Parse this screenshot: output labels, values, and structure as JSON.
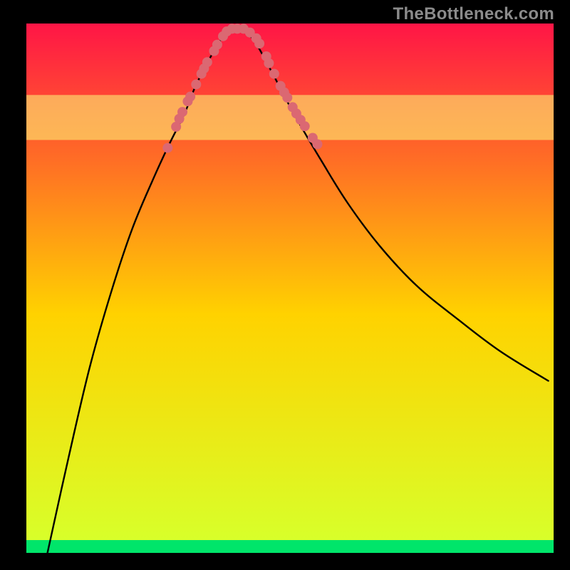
{
  "watermark": "TheBottleneck.com",
  "chart_data": {
    "type": "line",
    "title": "",
    "xlabel": "",
    "ylabel": "",
    "xlim": [
      0,
      100
    ],
    "ylim": [
      0,
      100
    ],
    "grid": false,
    "legend": false,
    "background_gradient": {
      "top": "#ff1546",
      "mid": "#ffd200",
      "bottom": "#00e56a"
    },
    "bottom_highlight_band": {
      "y_from": 78,
      "y_to": 86.5,
      "color": "#fbff7a"
    },
    "series": [
      {
        "name": "bottleneck-curve",
        "color": "#000000",
        "x": [
          4,
          8,
          12,
          16,
          20,
          24,
          27,
          30,
          32,
          34,
          36,
          37.5,
          39,
          40.5,
          42,
          44,
          47,
          51,
          56,
          61,
          67,
          74,
          82,
          90,
          99
        ],
        "y": [
          0,
          18,
          35,
          49,
          61,
          70.5,
          77,
          83,
          88,
          92,
          95.5,
          97.8,
          99,
          99,
          98.2,
          95.5,
          90,
          82.5,
          74,
          66,
          58,
          50.5,
          44,
          38,
          32.5
        ]
      }
    ],
    "markers": {
      "name": "highlight-dots",
      "color": "#db6872",
      "radius": 7,
      "points": [
        {
          "x": 26.8,
          "y": 76.5
        },
        {
          "x": 28.4,
          "y": 80.5
        },
        {
          "x": 29.0,
          "y": 82.0
        },
        {
          "x": 29.6,
          "y": 83.3
        },
        {
          "x": 30.6,
          "y": 85.3
        },
        {
          "x": 31.1,
          "y": 86.2
        },
        {
          "x": 32.2,
          "y": 88.5
        },
        {
          "x": 33.2,
          "y": 90.5
        },
        {
          "x": 33.7,
          "y": 91.5
        },
        {
          "x": 34.3,
          "y": 92.7
        },
        {
          "x": 35.6,
          "y": 94.8
        },
        {
          "x": 36.2,
          "y": 96.0
        },
        {
          "x": 37.3,
          "y": 97.6
        },
        {
          "x": 38.0,
          "y": 98.5
        },
        {
          "x": 39.0,
          "y": 99.0
        },
        {
          "x": 40.0,
          "y": 99.0
        },
        {
          "x": 41.2,
          "y": 99.0
        },
        {
          "x": 42.4,
          "y": 98.3
        },
        {
          "x": 43.6,
          "y": 97.2
        },
        {
          "x": 44.2,
          "y": 96.2
        },
        {
          "x": 45.5,
          "y": 93.8
        },
        {
          "x": 46.0,
          "y": 92.5
        },
        {
          "x": 47.0,
          "y": 90.5
        },
        {
          "x": 48.2,
          "y": 88.2
        },
        {
          "x": 48.9,
          "y": 87.0
        },
        {
          "x": 49.5,
          "y": 86.0
        },
        {
          "x": 50.5,
          "y": 84.2
        },
        {
          "x": 51.2,
          "y": 83.0
        },
        {
          "x": 52.0,
          "y": 81.8
        },
        {
          "x": 52.8,
          "y": 80.6
        },
        {
          "x": 54.3,
          "y": 78.4
        },
        {
          "x": 55.2,
          "y": 77.2
        }
      ]
    }
  }
}
